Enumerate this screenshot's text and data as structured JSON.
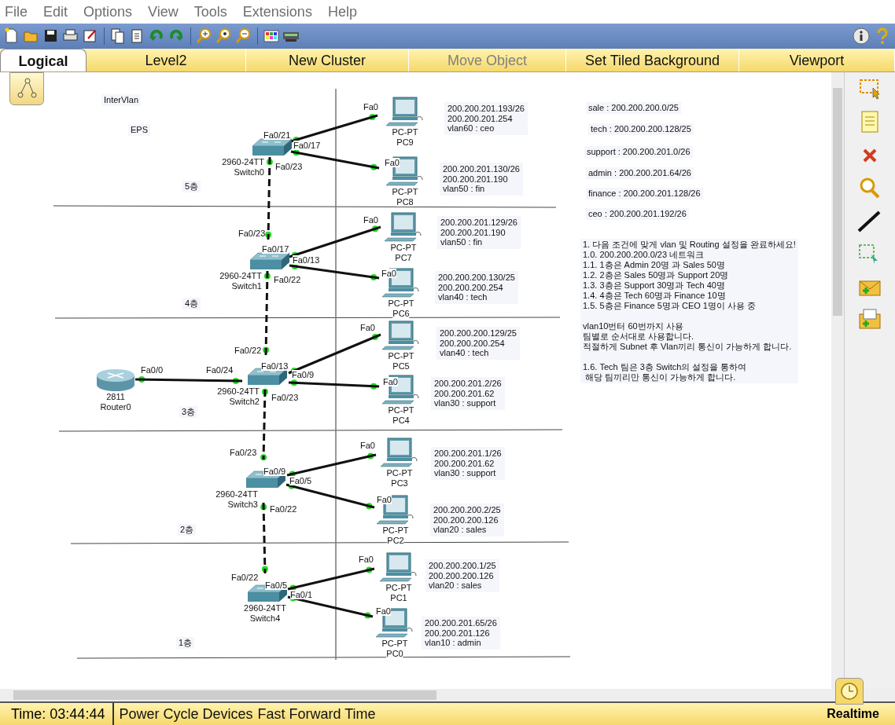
{
  "menu": [
    "File",
    "Edit",
    "Options",
    "View",
    "Tools",
    "Extensions",
    "Help"
  ],
  "tabs": [
    {
      "label": "Logical",
      "selected": true,
      "disabled": false
    },
    {
      "label": "Level2",
      "selected": false,
      "disabled": false
    },
    {
      "label": "New Cluster",
      "selected": false,
      "disabled": false
    },
    {
      "label": "Move Object",
      "selected": false,
      "disabled": true
    },
    {
      "label": "Set Tiled Background",
      "selected": false,
      "disabled": false
    },
    {
      "label": "Viewport",
      "selected": false,
      "disabled": false
    }
  ],
  "canvas": {
    "notes": [
      {
        "text": "InterVlan"
      },
      {
        "text": "EPS"
      },
      {
        "text": "5층"
      },
      {
        "text": "4층"
      },
      {
        "text": "3층"
      },
      {
        "text": "2층"
      },
      {
        "text": "1층"
      },
      {
        "text": "sale : 200.200.200.0/25"
      },
      {
        "text": "tech : 200.200.200.128/25"
      },
      {
        "text": "support : 200.200.201.0/26"
      },
      {
        "text": "admin : 200.200.201.64/26"
      },
      {
        "text": "finance : 200.200.201.128/26"
      },
      {
        "text": "ceo : 200.200.201.192/26"
      },
      {
        "text": "1. 다음 조건에 맞게 vlan 및 Routing 설정을 완료하세요!\n1.0. 200.200.200.0/23 네트워크\n1.1. 1층은 Admin 20명 과 Sales 50명\n1.2. 2층은 Sales 50명과 Support 20명\n1.3. 3층은 Support 30명과 Tech 40명\n1.4. 4층은 Tech 60명과 Finance 10명\n1.5. 5층은 Finance 5명과 CEO 1명이 사용 중\n\nvlan10번터 60번까지 사용\n팀별로 순서대로 사용합니다.\n적절하게 Subnet 후 Vlan끼리 통신이 가능하게 합니다.\n\n1.6. Tech 팀은 3층 Switch의 설정을 통하여\n 해당 팀끼리만 통신이 가능하게 합니다."
      }
    ],
    "devices": [
      {
        "kind": "switch",
        "model": "2960-24TT",
        "name": "Switch0"
      },
      {
        "kind": "pc",
        "model": "PC-PT",
        "name": "PC9",
        "info": [
          "200.200.201.193/26",
          "200.200.201.254",
          "vlan60 : ceo"
        ]
      },
      {
        "kind": "pc",
        "model": "PC-PT",
        "name": "PC8",
        "info": [
          "200.200.201.130/26",
          "200.200.201.190",
          "vlan50 : fin"
        ]
      },
      {
        "kind": "switch",
        "model": "2960-24TT",
        "name": "Switch1"
      },
      {
        "kind": "pc",
        "model": "PC-PT",
        "name": "PC7",
        "info": [
          "200.200.201.129/26",
          "200.200.201.190",
          "vlan50 : fin"
        ]
      },
      {
        "kind": "pc",
        "model": "PC-PT",
        "name": "PC6",
        "info": [
          "200.200.200.130/25",
          "200.200.200.254",
          "vlan40 : tech"
        ]
      },
      {
        "kind": "router",
        "model": "2811",
        "name": "Router0"
      },
      {
        "kind": "switch",
        "model": "2960-24TT",
        "name": "Switch2"
      },
      {
        "kind": "pc",
        "model": "PC-PT",
        "name": "PC5",
        "info": [
          "200.200.200.129/25",
          "200.200.200.254",
          "vlan40 : tech"
        ]
      },
      {
        "kind": "pc",
        "model": "PC-PT",
        "name": "PC4",
        "info": [
          "200.200.201.2/26",
          "200.200.201.62",
          "vlan30 : support"
        ]
      },
      {
        "kind": "switch",
        "model": "2960-24TT",
        "name": "Switch3"
      },
      {
        "kind": "pc",
        "model": "PC-PT",
        "name": "PC3",
        "info": [
          "200.200.201.1/26",
          "200.200.201.62",
          "vlan30 : support"
        ]
      },
      {
        "kind": "pc",
        "model": "PC-PT",
        "name": "PC2",
        "info": [
          "200.200.200.2/25",
          "200.200.200.126",
          "vlan20 : sales"
        ]
      },
      {
        "kind": "switch",
        "model": "2960-24TT",
        "name": "Switch4"
      },
      {
        "kind": "pc",
        "model": "PC-PT",
        "name": "PC1",
        "info": [
          "200.200.200.1/25",
          "200.200.200.126",
          "vlan20 : sales"
        ]
      },
      {
        "kind": "pc",
        "model": "PC-PT",
        "name": "PC0",
        "info": [
          "200.200.201.65/26",
          "200.200.201.126",
          "vlan10 : admin"
        ]
      }
    ],
    "links": [
      {
        "dashed": false,
        "ports": [
          "Fa0/21",
          "Fa0"
        ]
      },
      {
        "dashed": false,
        "ports": [
          "Fa0/17",
          "Fa0"
        ]
      },
      {
        "dashed": true,
        "ports": [
          "Fa0/23",
          "Fa0/23"
        ]
      },
      {
        "dashed": false,
        "ports": [
          "Fa0/17",
          "Fa0"
        ]
      },
      {
        "dashed": false,
        "ports": [
          "Fa0/13",
          "Fa0"
        ]
      },
      {
        "dashed": true,
        "ports": [
          "Fa0/22",
          "Fa0/22"
        ]
      },
      {
        "dashed": false,
        "ports": [
          "Fa0/0",
          "Fa0/24"
        ]
      },
      {
        "dashed": false,
        "ports": [
          "Fa0/13",
          "Fa0"
        ]
      },
      {
        "dashed": false,
        "ports": [
          "Fa0/9",
          "Fa0"
        ]
      },
      {
        "dashed": true,
        "ports": [
          "Fa0/23",
          "Fa0/23"
        ]
      },
      {
        "dashed": false,
        "ports": [
          "Fa0/9",
          "Fa0"
        ]
      },
      {
        "dashed": false,
        "ports": [
          "Fa0/5",
          "Fa0"
        ]
      },
      {
        "dashed": true,
        "ports": [
          "Fa0/22",
          "Fa0/22"
        ]
      },
      {
        "dashed": false,
        "ports": [
          "Fa0/5",
          "Fa0"
        ]
      },
      {
        "dashed": false,
        "ports": [
          "Fa0/1",
          "Fa0"
        ]
      }
    ]
  },
  "status_bar": {
    "time": "Time: 03:44:44",
    "buttons": [
      "Power Cycle Devices",
      "Fast Forward Time"
    ],
    "mode": "Realtime"
  }
}
